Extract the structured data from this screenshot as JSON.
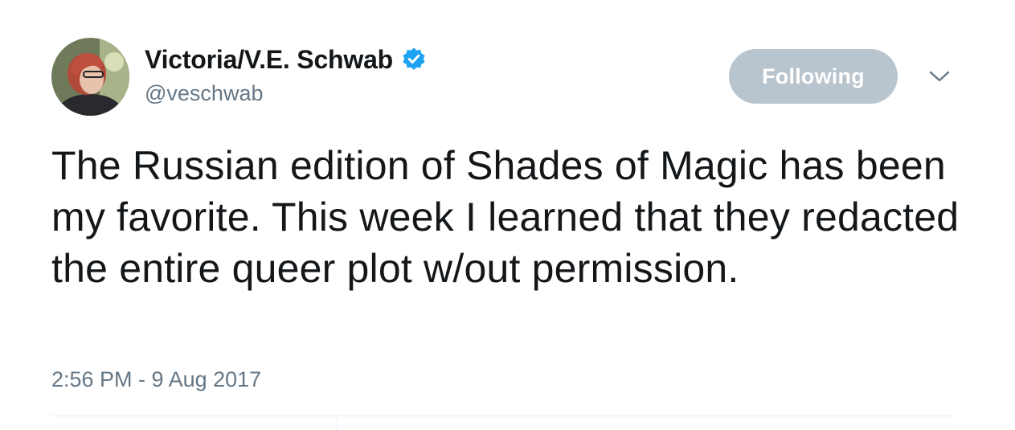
{
  "author": {
    "display_name": "Victoria/V.E. Schwab",
    "handle": "@veschwab",
    "verified": true,
    "avatar_icon": "profile-photo"
  },
  "follow_button": {
    "label": "Following"
  },
  "menu": {
    "icon": "chevron-down-icon"
  },
  "tweet": {
    "text": "The Russian edition of Shades of Magic has been my favorite. This week I learned that they redacted the entire queer plot w/out permission.",
    "timestamp": "2:56 PM - 9 Aug 2017"
  },
  "colors": {
    "text_primary": "#14171a",
    "text_secondary": "#657786",
    "verified_blue": "#1da1f2",
    "following_button_bg": "#b8c4ce",
    "divider": "#e6ecf0"
  }
}
